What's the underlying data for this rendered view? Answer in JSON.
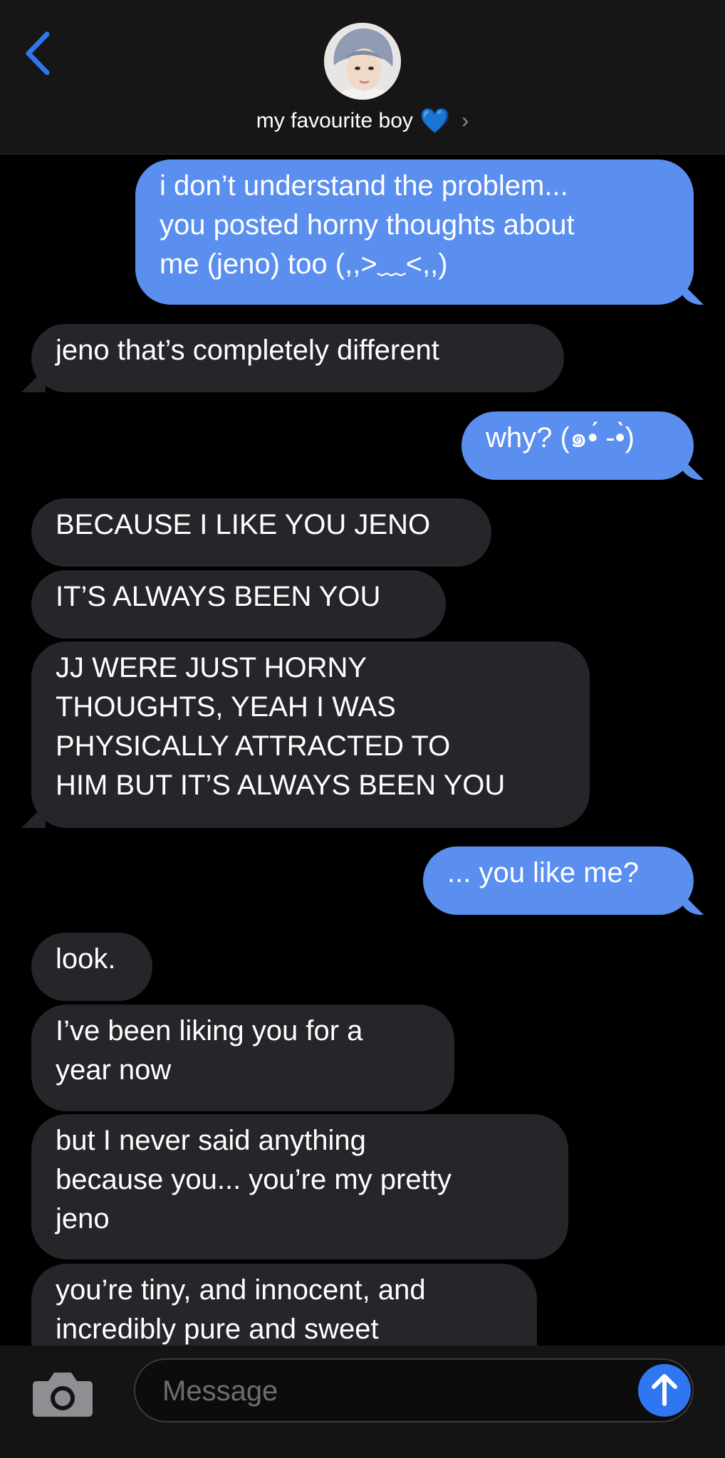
{
  "header": {
    "contact_name": "my favourite boy",
    "contact_emoji": "💙",
    "chevron": "›",
    "back_icon": "chevron-left-icon"
  },
  "messages": [
    {
      "from": "me",
      "lines": [
        "i don’t understand the problem...",
        "you posted horny thoughts about",
        "me (jeno) too (,,>﹏<,,)"
      ]
    },
    {
      "from": "them",
      "lines": [
        "jeno that’s completely different"
      ]
    },
    {
      "from": "me",
      "lines": [
        "why? (๑•́ -•̀)"
      ]
    },
    {
      "from": "them",
      "lines": [
        "BECAUSE I LIKE YOU JENO"
      ]
    },
    {
      "from": "them",
      "lines": [
        "IT’S ALWAYS BEEN YOU"
      ]
    },
    {
      "from": "them",
      "lines": [
        "JJ WERE JUST HORNY",
        "THOUGHTS, YEAH I WAS",
        "PHYSICALLY ATTRACTED TO",
        "HIM BUT IT’S ALWAYS BEEN YOU"
      ]
    },
    {
      "from": "me",
      "lines": [
        "... you like me?"
      ]
    },
    {
      "from": "them",
      "lines": [
        "look."
      ]
    },
    {
      "from": "them",
      "lines": [
        "I’ve been liking you for a",
        "year now"
      ]
    },
    {
      "from": "them",
      "lines": [
        "but I never said anything",
        "because you... you’re my pretty",
        "jeno"
      ]
    },
    {
      "from": "them",
      "lines": [
        "you’re tiny, and innocent, and",
        "incredibly pure and sweet"
      ]
    }
  ],
  "input": {
    "placeholder": "Message",
    "camera_icon": "camera-icon",
    "send_icon": "arrow-up-icon"
  },
  "colors": {
    "sent_bubble": "#5a8fef",
    "received_bubble": "#26262a",
    "background": "#000000",
    "accent": "#2f76f0"
  }
}
